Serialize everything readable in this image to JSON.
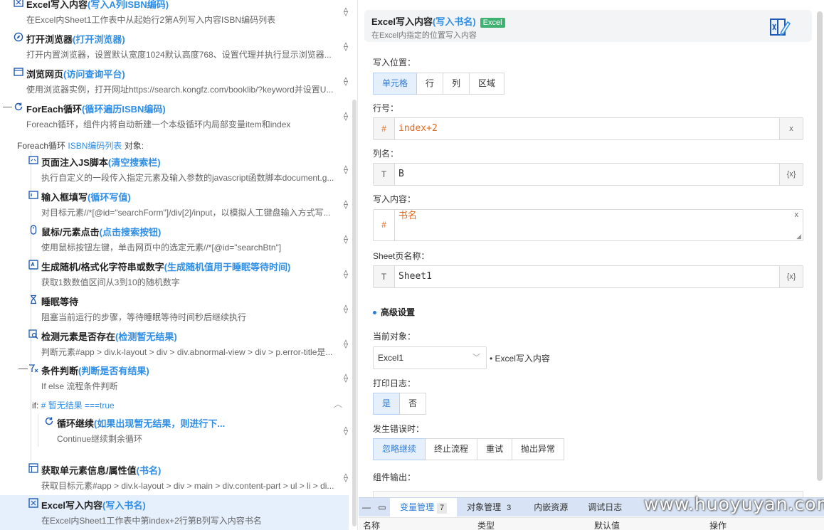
{
  "left_panel": {
    "steps": [
      {
        "title": "Excel写入内容",
        "sub": "(写入A列ISBN编码)",
        "desc": "在Excel内Sheet1工作表中从起始行2第A列写入内容ISBN编码列表",
        "icon": "excel-write-icon"
      },
      {
        "title": "打开浏览器",
        "sub": "(打开浏览器)",
        "desc": "打开内置浏览器，设置默认宽度1024默认高度768、设置代理并执行显示浏览器...",
        "icon": "compass-icon"
      },
      {
        "title": "浏览网页",
        "sub": "(访问查询平台)",
        "desc": "使用浏览器实例，打开网址https://search.kongfz.com/booklib/?keyword并设置U...",
        "icon": "web-page-icon"
      },
      {
        "title": "ForEach循环",
        "sub": "(循环遍历ISBN编码)",
        "desc": "Foreach循环，组件内将自动新建一个本级循环内局部变量item和index",
        "icon": "foreach-icon"
      },
      {
        "title": "页面注入JS脚本",
        "sub": "(清空搜索栏)",
        "desc": "执行自定义的一段传入指定元素及输入参数的javascript函数脚本document.g...",
        "icon": "js-script-icon"
      },
      {
        "title": "输入框填写",
        "sub": "(循环写值)",
        "desc": "对目标元素//*[@id=\"searchForm\"]/div[2]/input，以模拟人工键盘输入方式写...",
        "icon": "input-fill-icon"
      },
      {
        "title": "鼠标/元素点击",
        "sub": "(点击搜索按钮)",
        "desc": "使用鼠标按钮左键，单击网页中的选定元素//*[@id=\"searchBtn\"]",
        "icon": "mouse-icon"
      },
      {
        "title": "生成随机/格式化字符串或数字",
        "sub": "(生成随机值用于睡眠等待时间)",
        "desc": "获取1数数值区间从3到10的随机数字",
        "icon": "random-icon"
      },
      {
        "title": "睡眠等待",
        "sub": "",
        "desc": "阻塞当前运行的步骤，等待睡眠等待时间秒后继续执行",
        "icon": "hourglass-icon"
      },
      {
        "title": "检测元素是否存在",
        "sub": "(检测暂无结果)",
        "desc": "判断元素#app > div.k-layout > div > div.abnormal-view > div > p.error-title是...",
        "icon": "detect-element-icon"
      },
      {
        "title": "条件判断",
        "sub": "(判断是否有结果)",
        "desc": "If else 流程条件判断",
        "icon": "condition-icon"
      },
      {
        "title": "循环继续",
        "sub": "(如果出现暂无结果，则进行下...",
        "desc": "Continue继续剩余循环",
        "icon": "loop-continue-icon"
      },
      {
        "title": "获取单元素信息/属性值",
        "sub": "(书名)",
        "desc": "获取目标元素#app > div.k-layout > div > main > div.content-part > ul > li > di...",
        "icon": "element-info-icon"
      },
      {
        "title": "Excel写入内容",
        "sub": "(写入书名)",
        "desc": "在Excel内Sheet1工作表中第index+2行第B列写入内容书名",
        "icon": "excel-write-icon"
      }
    ],
    "foreach_label": "Foreach循环",
    "foreach_var": "ISBN编码列表",
    "foreach_suffix": "对象:",
    "if_label": "if:",
    "if_expr": "# 暂无结果 ===true"
  },
  "header": {
    "title": "Excel写入内容",
    "sub": "(写入书名)",
    "badge": "Excel",
    "desc": "在Excel内指定的位置写入内容"
  },
  "form": {
    "position_label": "写入位置：",
    "position_options": [
      "单元格",
      "行",
      "列",
      "区域"
    ],
    "position_selected": "单元格",
    "row_label": "行号：",
    "row_prefix": "#",
    "row_value": "index+2",
    "row_suffix": "x",
    "col_label": "列名：",
    "col_prefix": "T",
    "col_value": "B",
    "col_suffix": "{x}",
    "content_label": "写入内容：",
    "content_prefix": "#",
    "content_value": "书名",
    "content_suffix": "x",
    "sheet_label": "Sheet页名称：",
    "sheet_prefix": "T",
    "sheet_value": "Sheet1",
    "sheet_suffix": "{x}",
    "advanced_label": "高级设置",
    "current_obj_label": "当前对象：",
    "current_obj_value": "Excel1",
    "current_obj_desc": "• Excel写入内容",
    "log_label": "打印日志：",
    "log_options": [
      "是",
      "否"
    ],
    "error_label": "发生错误时：",
    "error_options": [
      "忽略继续",
      "终止流程",
      "重试",
      "抛出异常"
    ],
    "output_label": "组件输出："
  },
  "bottom": {
    "tabs": [
      {
        "label": "变量管理",
        "count": "7"
      },
      {
        "label": "对象管理",
        "count": "3"
      },
      {
        "label": "内嵌资源",
        "count": ""
      },
      {
        "label": "调试日志",
        "count": ""
      }
    ],
    "columns": [
      "名称",
      "类型",
      "默认值",
      "操作"
    ]
  },
  "watermark": "www.huoyuyan.com",
  "colors": {
    "accent": "#2f7bd6",
    "link": "#2f8ee6",
    "selected_bg": "#e6effc",
    "badge": "#3cb371"
  }
}
